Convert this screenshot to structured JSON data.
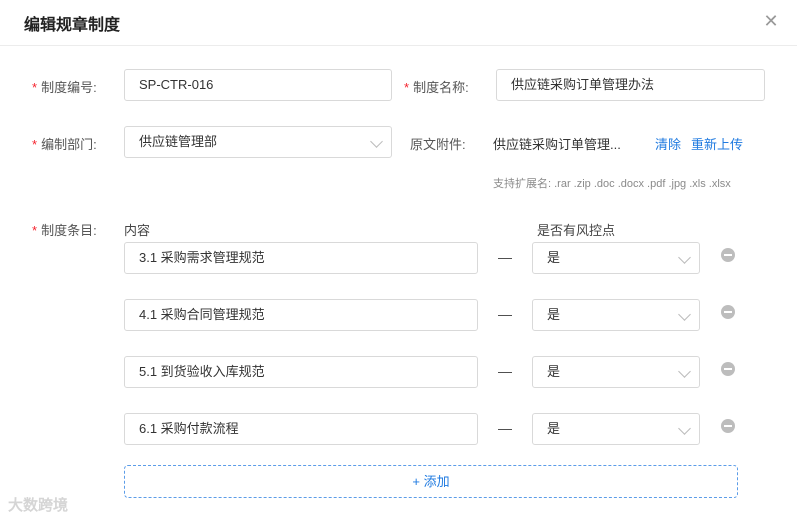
{
  "dialog": {
    "title": "编辑规章制度",
    "close_icon": "close-icon"
  },
  "form": {
    "required_mark": "*",
    "code": {
      "label": "制度编号:",
      "value": "SP-CTR-016"
    },
    "name": {
      "label": "制度名称:",
      "value": "供应链采购订单管理办法"
    },
    "dept": {
      "label": "编制部门:",
      "value": "供应链管理部"
    },
    "attachment": {
      "label": "原文附件:",
      "file": "供应链采购订单管理...",
      "clear": "清除",
      "reupload": "重新上传",
      "hint": "支持扩展名: .rar .zip .doc .docx .pdf .jpg .xls .xlsx"
    },
    "items": {
      "label": "制度条目:",
      "col_content": "内容",
      "col_risk": "是否有风控点",
      "separator": "—",
      "rows": [
        {
          "content": "3.1   采购需求管理规范",
          "risk": "是"
        },
        {
          "content": "4.1   采购合同管理规范",
          "risk": "是"
        },
        {
          "content": "5.1   到货验收入库规范",
          "risk": "是"
        },
        {
          "content": "6.1   采购付款流程",
          "risk": "是"
        }
      ],
      "add_label": "+ 添加"
    }
  },
  "watermark": "大数跨境"
}
